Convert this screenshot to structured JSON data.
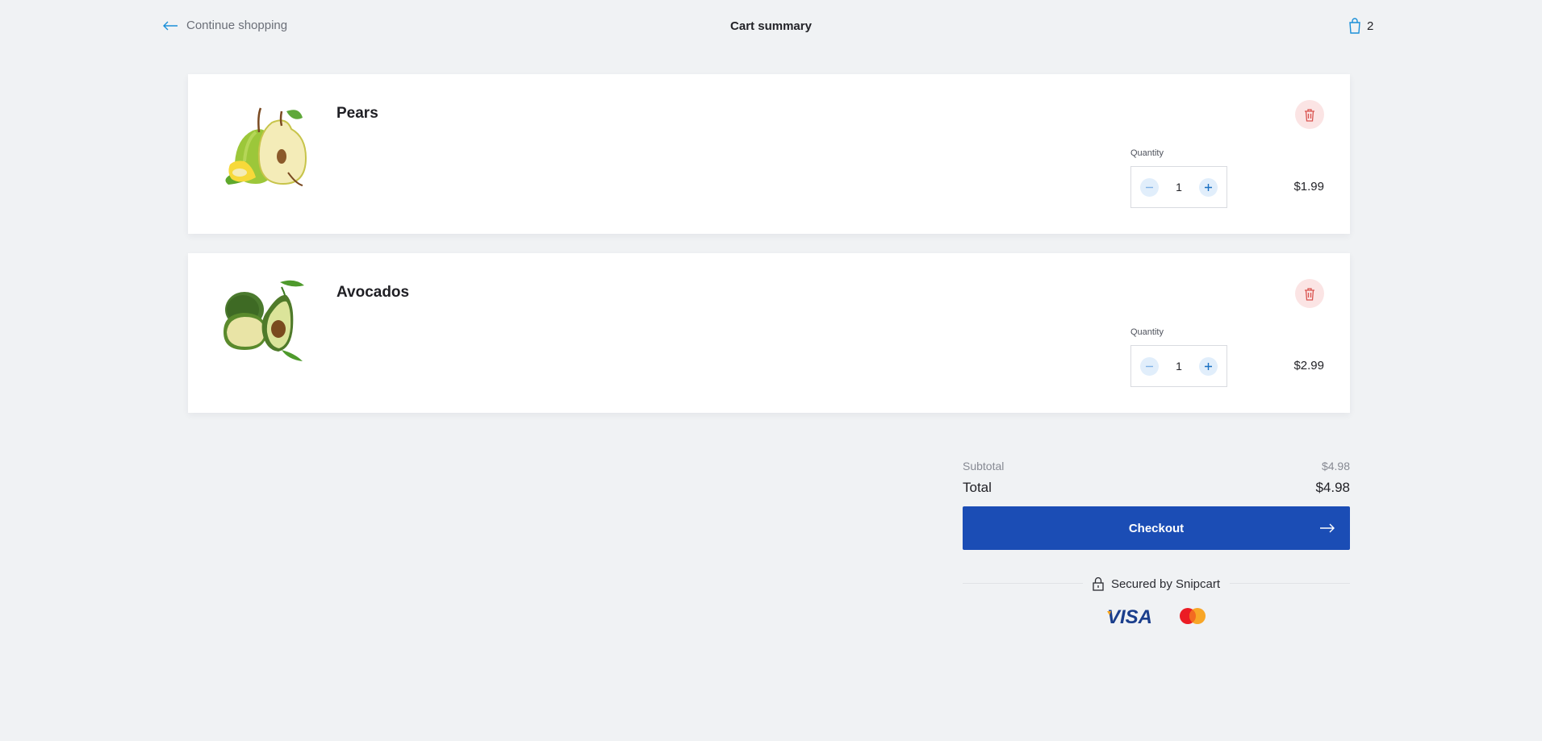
{
  "header": {
    "back_label": "Continue shopping",
    "title": "Cart summary",
    "cart_count": "2"
  },
  "items": [
    {
      "name": "Pears",
      "quantity_label": "Quantity",
      "quantity": "1",
      "price": "$1.99"
    },
    {
      "name": "Avocados",
      "quantity_label": "Quantity",
      "quantity": "1",
      "price": "$2.99"
    }
  ],
  "summary": {
    "subtotal_label": "Subtotal",
    "subtotal_value": "$4.98",
    "total_label": "Total",
    "total_value": "$4.98",
    "checkout_label": "Checkout",
    "secured_label": "Secured by Snipcart"
  },
  "payment_methods": [
    "VISA",
    "mastercard"
  ],
  "colors": {
    "background": "#f0f2f4",
    "primary": "#1b4db5",
    "accent_blue": "#1a8fd8",
    "remove_bg": "#fbe4e4",
    "remove_icon": "#d9534f",
    "qty_btn_bg": "#e1eefb"
  },
  "icons": {
    "back": "arrow-left-icon",
    "cart": "shopping-bag-icon",
    "remove": "trash-icon",
    "decrease": "minus-icon",
    "increase": "plus-icon",
    "checkout": "arrow-right-icon",
    "secure": "lock-icon"
  }
}
